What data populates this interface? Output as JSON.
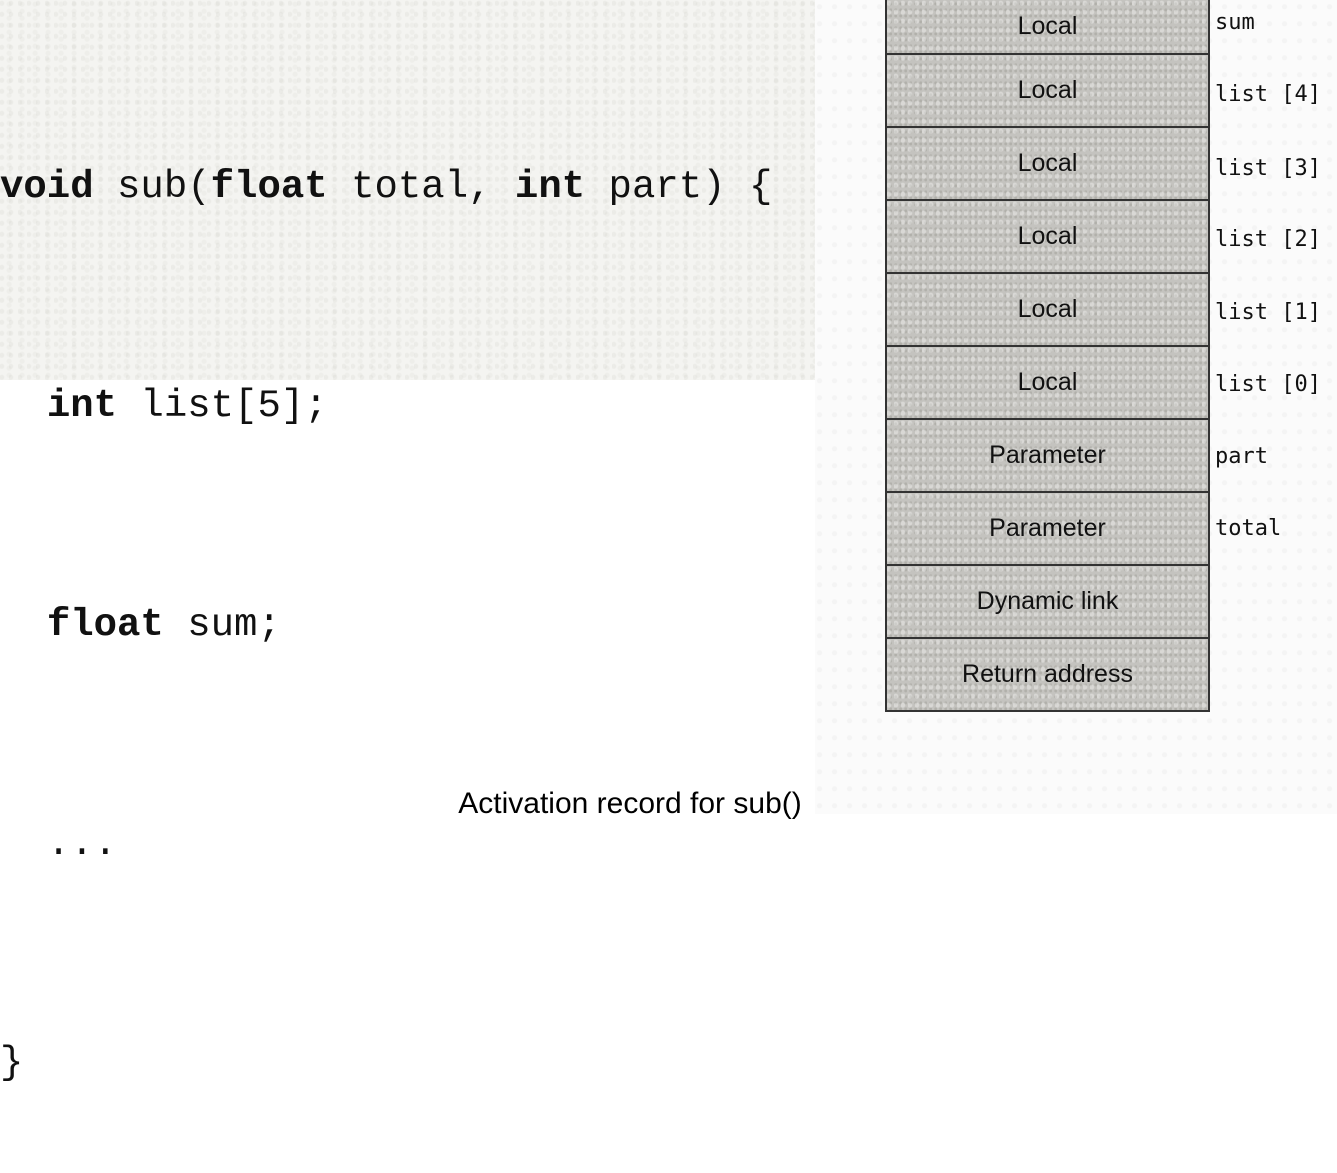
{
  "code": {
    "line1": {
      "kw1": "void",
      "t1": " sub(",
      "kw2": "float",
      "t2": " total, ",
      "kw3": "int",
      "t3": " part) {"
    },
    "line2": {
      "kw1": "int",
      "t1": " list[5];"
    },
    "line3": {
      "kw1": "float",
      "t1": " sum;"
    },
    "line4": "...",
    "line5": "}"
  },
  "activation_record": {
    "cells": [
      "Local",
      "Local",
      "Local",
      "Local",
      "Local",
      "Local",
      "Parameter",
      "Parameter",
      "Dynamic link",
      "Return address"
    ],
    "variables": [
      "sum",
      "list [4]",
      "list [3]",
      "list [2]",
      "list [1]",
      "list [0]",
      "part",
      "total"
    ]
  },
  "caption": "Activation record for sub()"
}
